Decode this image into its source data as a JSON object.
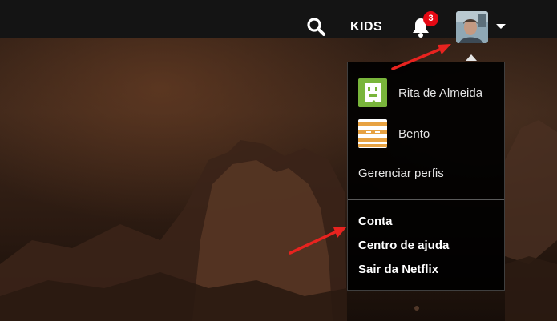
{
  "header": {
    "kids_label": "KIDS",
    "notification_count": "3",
    "badge_color": "#e50914"
  },
  "icons": {
    "search": "search-icon",
    "bell": "bell-icon",
    "avatar": "avatar",
    "caret": "caret-down-icon"
  },
  "menu": {
    "profiles": [
      {
        "name": "Rita de Almeida",
        "avatar_icon": "green-face-avatar",
        "avatar_color": "#79b53b"
      },
      {
        "name": "Bento",
        "avatar_icon": "orange-stripes-avatar",
        "avatar_color": "#e7a242"
      }
    ],
    "manage_profiles_label": "Gerenciar perfis",
    "account_links": [
      "Conta",
      "Centro de ajuda",
      "Sair da Netflix"
    ]
  },
  "annotations": {
    "arrow_color": "#e8231f"
  }
}
